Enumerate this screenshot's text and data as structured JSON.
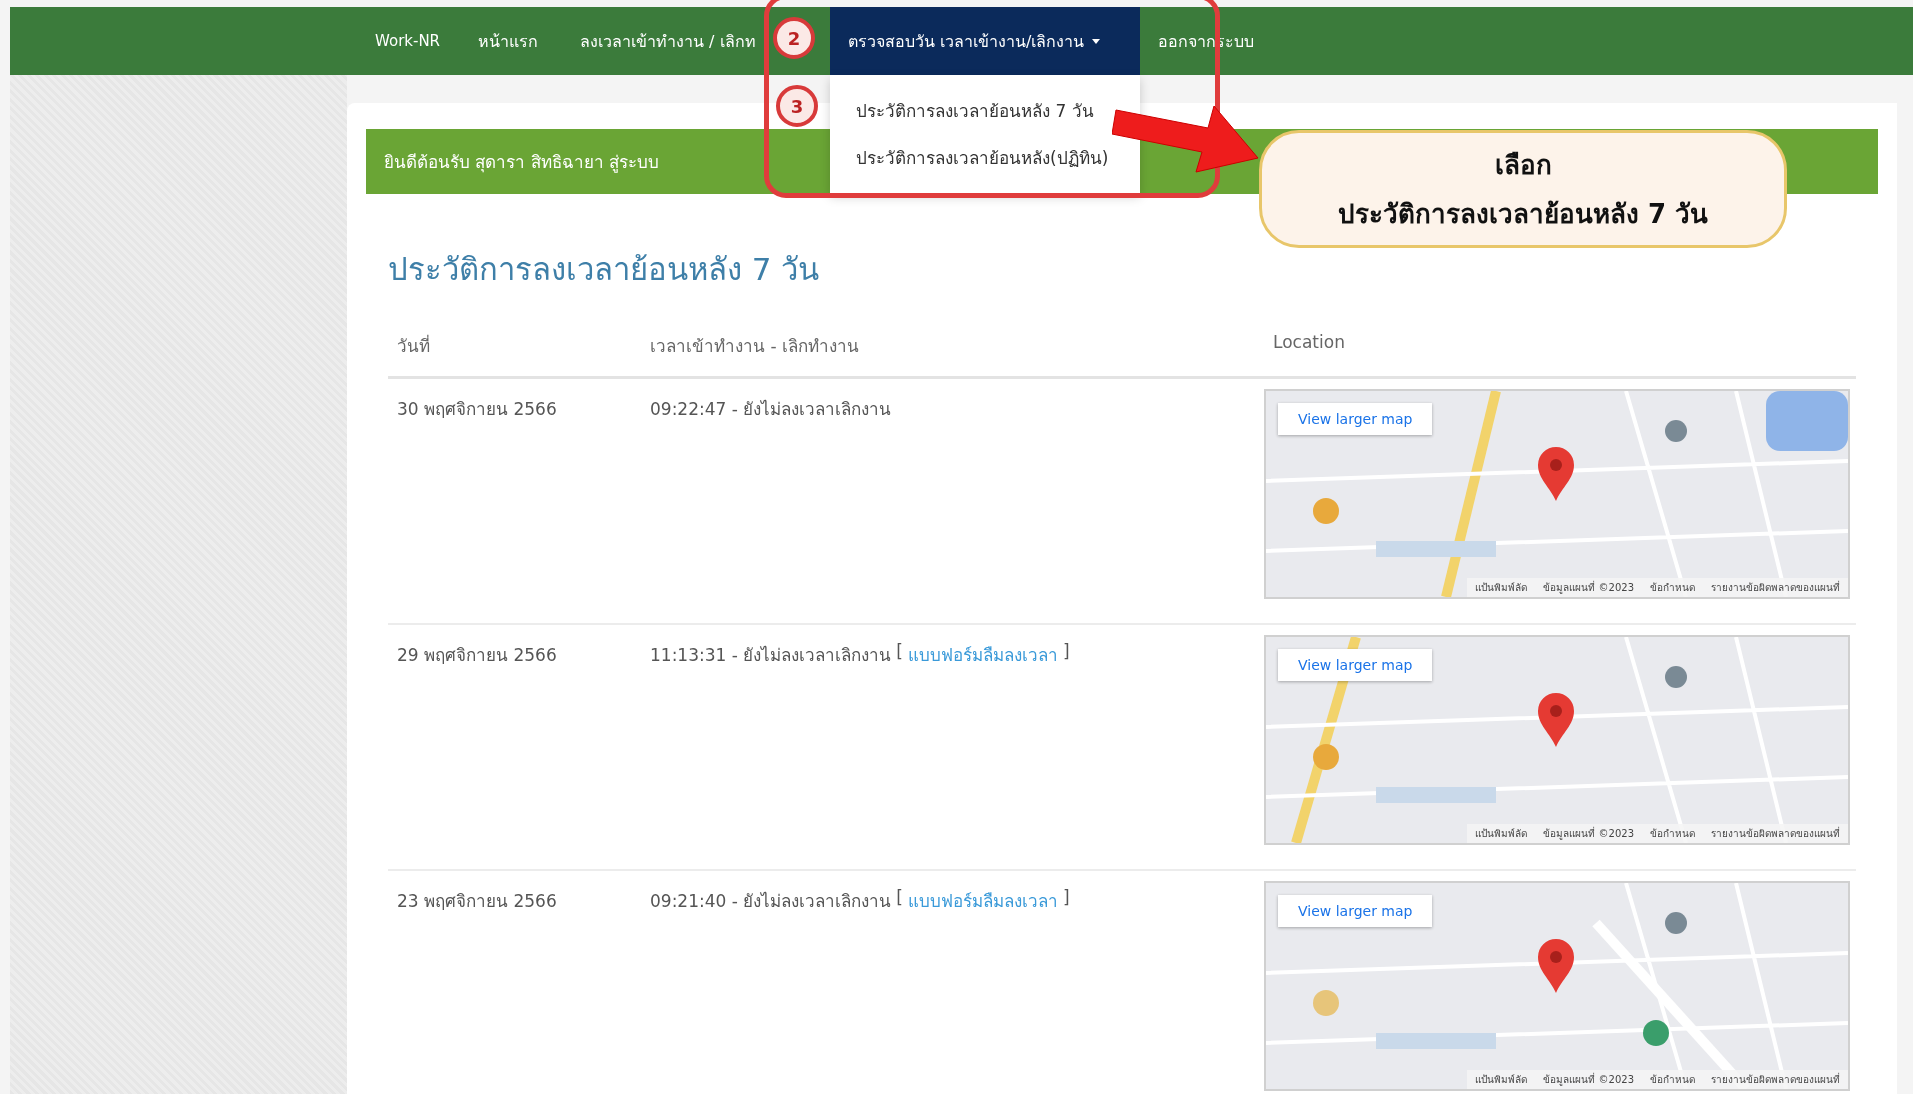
{
  "navbar": {
    "brand": "Work-NR",
    "items": [
      {
        "label": "หน้าแรก",
        "selected": false,
        "dropdown": false
      },
      {
        "label": "ลงเวลาเข้าทำงาน / เลิกท",
        "selected": false,
        "dropdown": false
      },
      {
        "label": "ตรวจสอบวัน เวลาเข้างาน/เลิกงาน",
        "selected": true,
        "dropdown": true
      },
      {
        "label": "ออกจากระบบ",
        "selected": false,
        "dropdown": false
      }
    ]
  },
  "dropdown_menu": {
    "items": [
      "ประวัติการลงเวลาย้อนหลัง 7 วัน",
      "ประวัติการลงเวลาย้อนหลัง(ปฏิทิน)"
    ]
  },
  "welcome_bar": "ยินดีต้อนรับ สุดารา สิทธิฉายา สู่ระบบ",
  "page_title": "ประวัติการลงเวลาย้อนหลัง 7 วัน",
  "table": {
    "columns": [
      "วันที่",
      "เวลาเข้าทำงาน - เลิกทำงาน",
      "Location"
    ],
    "rows": [
      {
        "date": "30 พฤศจิกายน 2566",
        "time": "09:22:47 - ยังไม่ลงเวลาเลิกงาน",
        "map": {
          "button": "View larger map",
          "footer": [
            "แป้นพิมพ์ลัด",
            "ข้อมูลแผนที่ ©2023",
            "ข้อกำหนด",
            "รายงานข้อผิดพลาดของแผนที่"
          ]
        }
      },
      {
        "date": "29 พฤศจิกายน 2566",
        "time": "11:13:31 - ยังไม่ลงเวลาเลิกงาน",
        "link": {
          "open": "[",
          "label": "แบบฟอร์มลืมลงเวลา",
          "close": "]"
        },
        "map": {
          "button": "View larger map",
          "footer": [
            "แป้นพิมพ์ลัด",
            "ข้อมูลแผนที่ ©2023",
            "ข้อกำหนด",
            "รายงานข้อผิดพลาดของแผนที่"
          ]
        }
      },
      {
        "date": "23 พฤศจิกายน 2566",
        "time": "09:21:40 - ยังไม่ลงเวลาเลิกงาน",
        "link": {
          "open": "[",
          "label": "แบบฟอร์มลืมลงเวลา",
          "close": "]"
        },
        "map": {
          "button": "View larger map",
          "footer": [
            "แป้นพิมพ์ลัด",
            "ข้อมูลแผนที่ ©2023",
            "ข้อกำหนด",
            "รายงานข้อผิดพลาดของแผนที่"
          ]
        }
      }
    ]
  },
  "annotations": {
    "steps": [
      "2",
      "3"
    ],
    "callout": [
      "เลือก",
      "ประวัติการลงเวลาย้อนหลัง 7 วัน"
    ]
  }
}
